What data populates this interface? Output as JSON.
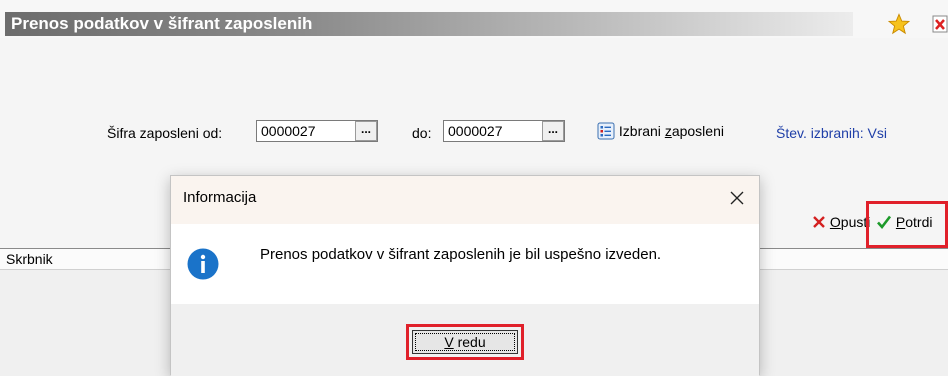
{
  "window": {
    "title": "Prenos podatkov v šifrant zaposlenih",
    "star_icon": "star-icon",
    "close_icon": "close-window-icon"
  },
  "form": {
    "from_label": "Šifra zaposleni od:",
    "from_value": "0000027",
    "to_label": "do:",
    "to_value": "0000027",
    "ellipsis": "...",
    "selected_employees_pre": "Izbrani ",
    "selected_employees_ul": "z",
    "selected_employees_post": "aposleni",
    "count_label": "Štev. izbranih: Vsi"
  },
  "actions": {
    "cancel_ul": "O",
    "cancel_rest": "pusti",
    "confirm_ul": "P",
    "confirm_rest": "otrdi"
  },
  "status": {
    "skrbnik": "Skrbnik"
  },
  "dialog": {
    "title": "Informacija",
    "message": "Prenos podatkov v šifrant zaposlenih je bil uspešno izveden.",
    "ok_ul": "V",
    "ok_rest": " redu"
  },
  "colors": {
    "highlight": "#e0202a",
    "link": "#1f3fa8",
    "info": "#1a73c9"
  }
}
